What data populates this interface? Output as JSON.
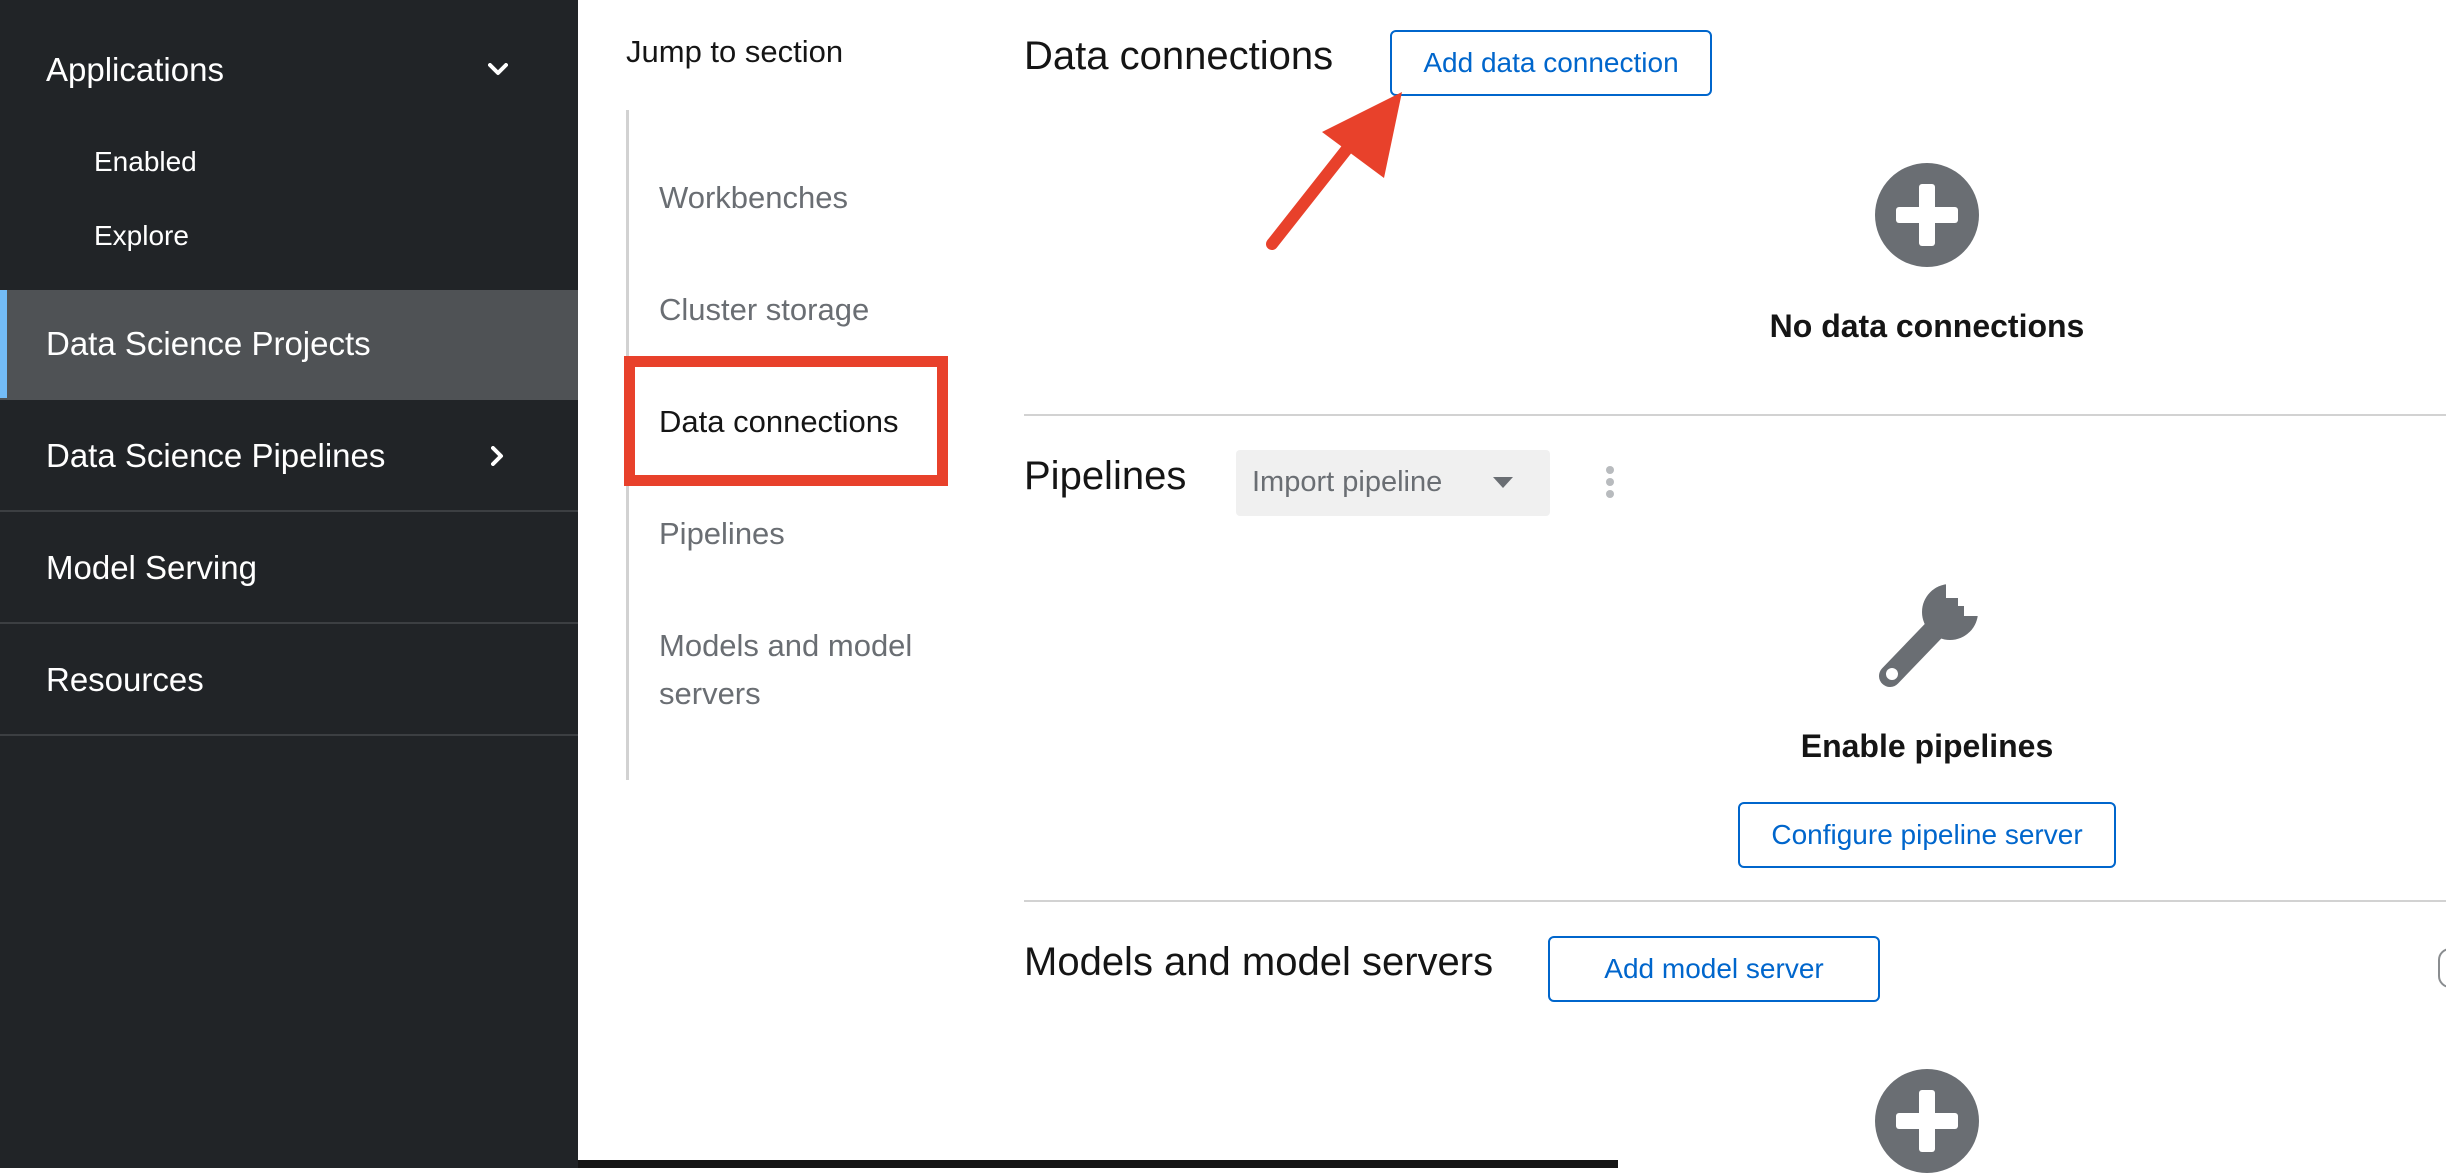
{
  "sidebar": {
    "applications": {
      "label": "Applications",
      "children": [
        {
          "label": "Enabled"
        },
        {
          "label": "Explore"
        }
      ]
    },
    "items": [
      {
        "label": "Data Science Projects",
        "active": true
      },
      {
        "label": "Data Science Pipelines",
        "has_children": true
      },
      {
        "label": "Model Serving"
      },
      {
        "label": "Resources"
      }
    ]
  },
  "jump": {
    "title": "Jump to section",
    "links": [
      {
        "label": "Workbenches"
      },
      {
        "label": "Cluster storage"
      },
      {
        "label": "Data connections",
        "current": true
      },
      {
        "label": "Pipelines"
      },
      {
        "label": "Models and model servers"
      }
    ]
  },
  "sections": {
    "data_connections": {
      "title": "Data connections",
      "button": "Add data connection",
      "empty_title": "No data connections"
    },
    "pipelines": {
      "title": "Pipelines",
      "dropdown": "Import pipeline",
      "empty_title": "Enable pipelines",
      "button": "Configure pipeline server"
    },
    "models": {
      "title": "Models and model servers",
      "button": "Add model server"
    }
  },
  "colors": {
    "sidebar_bg": "#212427",
    "active_item_bg": "#4f5255",
    "active_accent": "#73bcf7",
    "link_blue": "#0066cc",
    "annotation_red": "#e8412b",
    "empty_icon_gray": "#6a6e73"
  }
}
